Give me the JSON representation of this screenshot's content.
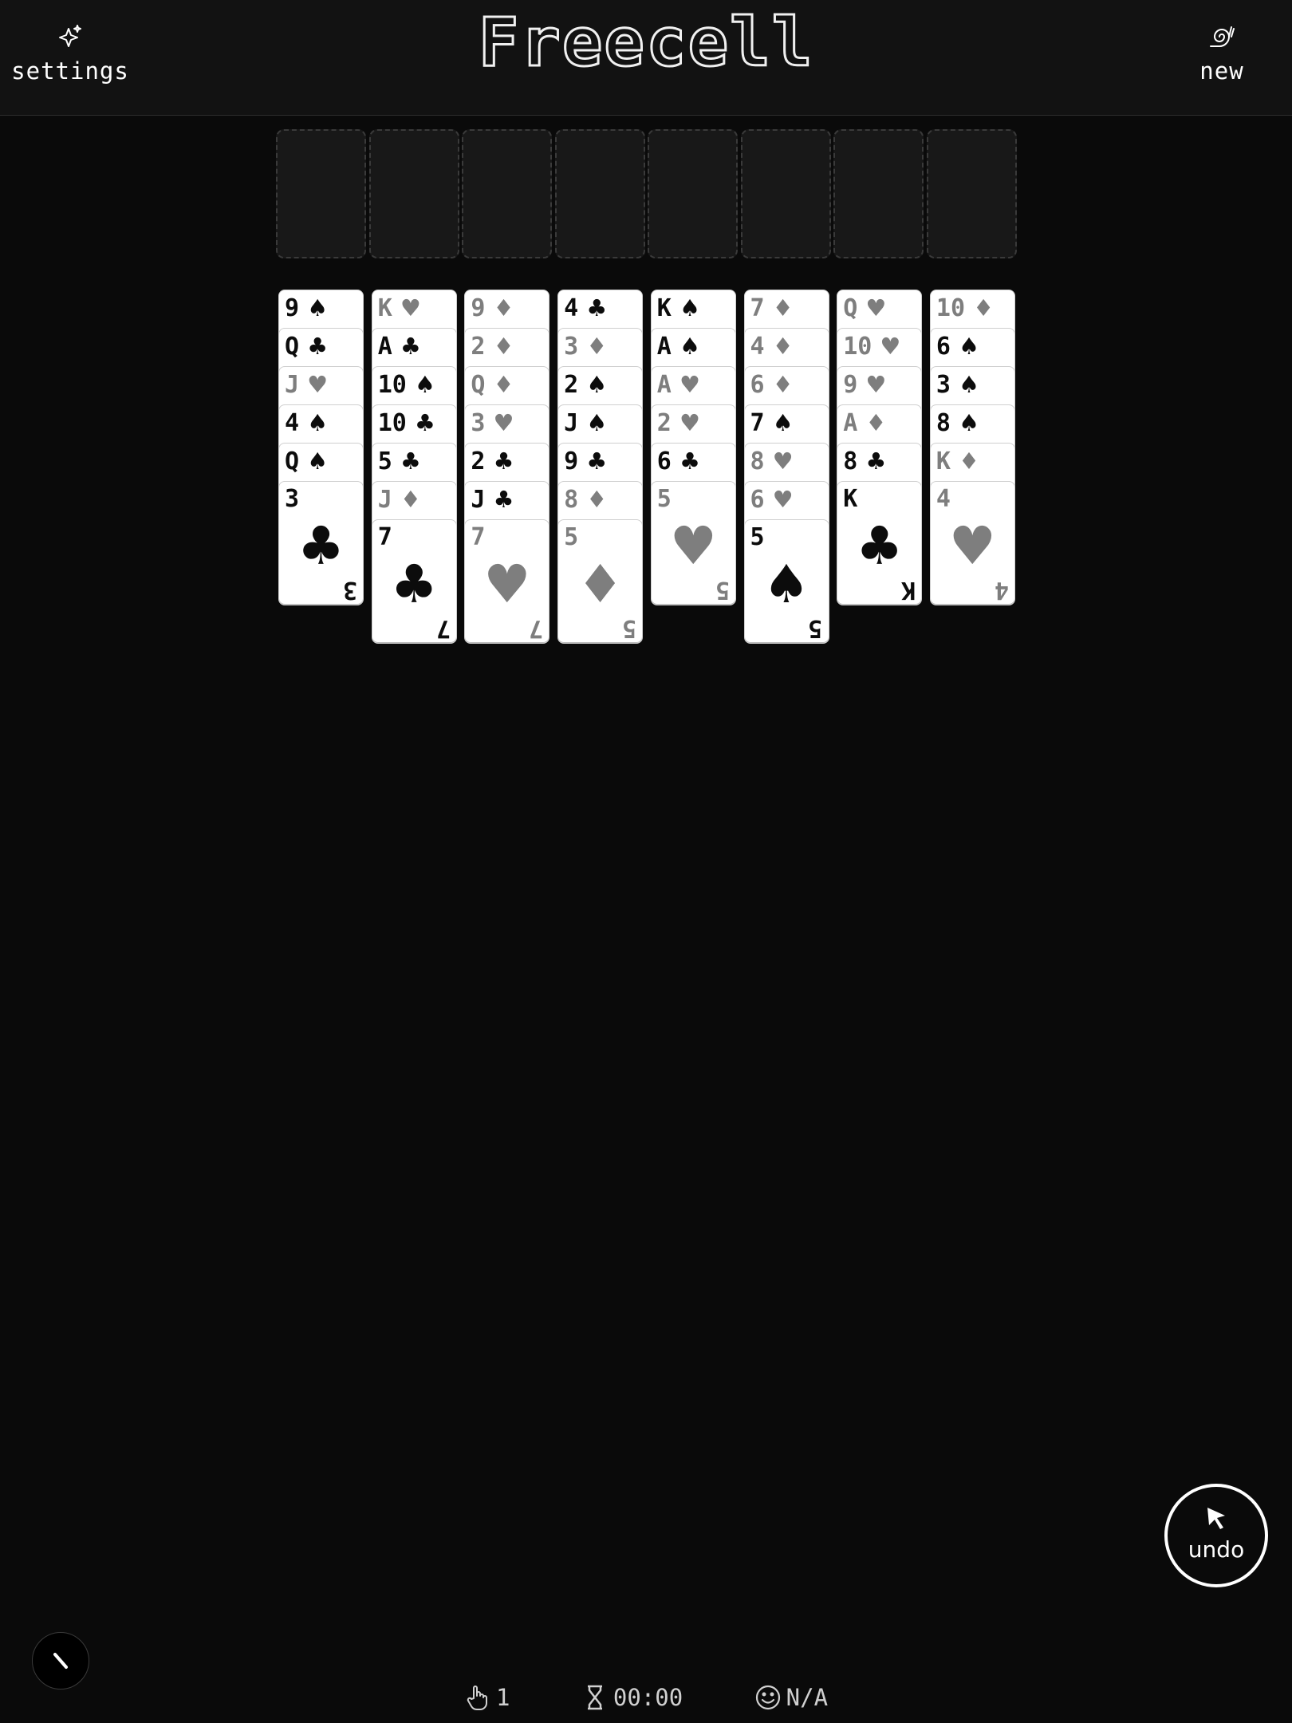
{
  "header": {
    "title": "Freecell",
    "settings_label": "settings",
    "settings_icon": "sparkle-icon",
    "new_label": "new",
    "new_icon": "snail-icon"
  },
  "free_cells_and_foundations": 8,
  "tableau": [
    [
      {
        "r": "9",
        "s": "♠",
        "c": "black"
      },
      {
        "r": "Q",
        "s": "♣",
        "c": "black"
      },
      {
        "r": "J",
        "s": "♥",
        "c": "red"
      },
      {
        "r": "4",
        "s": "♠",
        "c": "black"
      },
      {
        "r": "Q",
        "s": "♠",
        "c": "black"
      },
      {
        "r": "3",
        "s": "♣",
        "c": "black"
      }
    ],
    [
      {
        "r": "K",
        "s": "♥",
        "c": "red"
      },
      {
        "r": "A",
        "s": "♣",
        "c": "black"
      },
      {
        "r": "10",
        "s": "♠",
        "c": "black"
      },
      {
        "r": "10",
        "s": "♣",
        "c": "black"
      },
      {
        "r": "5",
        "s": "♣",
        "c": "black"
      },
      {
        "r": "J",
        "s": "♦",
        "c": "red"
      },
      {
        "r": "7",
        "s": "♣",
        "c": "black"
      }
    ],
    [
      {
        "r": "9",
        "s": "♦",
        "c": "red"
      },
      {
        "r": "2",
        "s": "♦",
        "c": "red"
      },
      {
        "r": "Q",
        "s": "♦",
        "c": "red"
      },
      {
        "r": "3",
        "s": "♥",
        "c": "red"
      },
      {
        "r": "2",
        "s": "♣",
        "c": "black"
      },
      {
        "r": "J",
        "s": "♣",
        "c": "black"
      },
      {
        "r": "7",
        "s": "♥",
        "c": "red"
      }
    ],
    [
      {
        "r": "4",
        "s": "♣",
        "c": "black"
      },
      {
        "r": "3",
        "s": "♦",
        "c": "red"
      },
      {
        "r": "2",
        "s": "♠",
        "c": "black"
      },
      {
        "r": "J",
        "s": "♠",
        "c": "black"
      },
      {
        "r": "9",
        "s": "♣",
        "c": "black"
      },
      {
        "r": "8",
        "s": "♦",
        "c": "red"
      },
      {
        "r": "5",
        "s": "♦",
        "c": "red"
      }
    ],
    [
      {
        "r": "K",
        "s": "♠",
        "c": "black"
      },
      {
        "r": "A",
        "s": "♠",
        "c": "black"
      },
      {
        "r": "A",
        "s": "♥",
        "c": "red"
      },
      {
        "r": "2",
        "s": "♥",
        "c": "red"
      },
      {
        "r": "6",
        "s": "♣",
        "c": "black"
      },
      {
        "r": "5",
        "s": "♥",
        "c": "red"
      }
    ],
    [
      {
        "r": "7",
        "s": "♦",
        "c": "red"
      },
      {
        "r": "4",
        "s": "♦",
        "c": "red"
      },
      {
        "r": "6",
        "s": "♦",
        "c": "red"
      },
      {
        "r": "7",
        "s": "♠",
        "c": "black"
      },
      {
        "r": "8",
        "s": "♥",
        "c": "red"
      },
      {
        "r": "6",
        "s": "♥",
        "c": "red"
      },
      {
        "r": "5",
        "s": "♠",
        "c": "black"
      }
    ],
    [
      {
        "r": "Q",
        "s": "♥",
        "c": "red"
      },
      {
        "r": "10",
        "s": "♥",
        "c": "red"
      },
      {
        "r": "9",
        "s": "♥",
        "c": "red"
      },
      {
        "r": "A",
        "s": "♦",
        "c": "red"
      },
      {
        "r": "8",
        "s": "♣",
        "c": "black"
      },
      {
        "r": "K",
        "s": "♣",
        "c": "black"
      }
    ],
    [
      {
        "r": "10",
        "s": "♦",
        "c": "red"
      },
      {
        "r": "6",
        "s": "♠",
        "c": "black"
      },
      {
        "r": "3",
        "s": "♠",
        "c": "black"
      },
      {
        "r": "8",
        "s": "♠",
        "c": "black"
      },
      {
        "r": "K",
        "s": "♦",
        "c": "red"
      },
      {
        "r": "4",
        "s": "♥",
        "c": "red"
      }
    ]
  ],
  "undo": {
    "label": "undo",
    "icon": "cursor-arrow-icon"
  },
  "status": {
    "moves_icon": "hand-pointer-icon",
    "moves": "1",
    "time_icon": "hourglass-icon",
    "time": "00:00",
    "score_icon": "smiley-icon",
    "score": "N/A"
  },
  "colors": {
    "background": "#0a0a0a",
    "header": "#121212",
    "red_suit": "#7e7e7e",
    "black_suit": "#0c0c0c"
  }
}
